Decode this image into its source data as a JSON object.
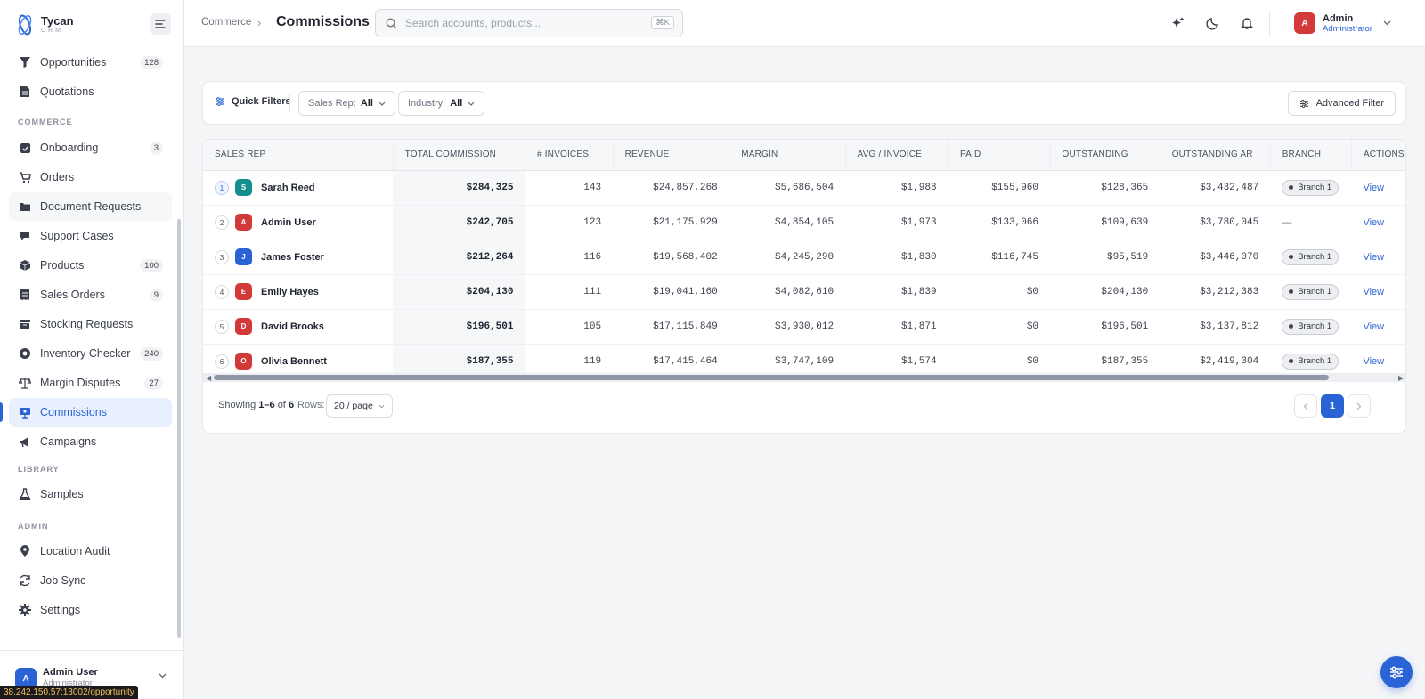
{
  "app": {
    "name": "Tycan",
    "sub": "CRM"
  },
  "sidebar": {
    "items": [
      {
        "label": "Opportunities",
        "count": "128",
        "icon": "funnel-icon"
      },
      {
        "label": "Quotations",
        "count": "",
        "icon": "document-icon"
      },
      {
        "label": "Onboarding",
        "count": "3",
        "icon": "clipboard-icon"
      },
      {
        "label": "Orders",
        "count": "",
        "icon": "cart-icon"
      },
      {
        "label": "Document Requests",
        "count": "",
        "icon": "folder-icon"
      },
      {
        "label": "Support Cases",
        "count": "",
        "icon": "chat-icon"
      },
      {
        "label": "Products",
        "count": "100",
        "icon": "box-icon"
      },
      {
        "label": "Sales Orders",
        "count": "9",
        "icon": "receipt-icon"
      },
      {
        "label": "Stocking Requests",
        "count": "",
        "icon": "archive-icon"
      },
      {
        "label": "Inventory Checker",
        "count": "240",
        "icon": "scan-icon"
      },
      {
        "label": "Margin Disputes",
        "count": "27",
        "icon": "scale-icon"
      },
      {
        "label": "Commissions",
        "count": "",
        "icon": "monitor-icon"
      },
      {
        "label": "Campaigns",
        "count": "",
        "icon": "megaphone-icon"
      },
      {
        "label": "Samples",
        "count": "",
        "icon": "flask-icon"
      },
      {
        "label": "Location Audit",
        "count": "",
        "icon": "pin-icon"
      },
      {
        "label": "Job Sync",
        "count": "",
        "icon": "sync-icon"
      },
      {
        "label": "Settings",
        "count": "",
        "icon": "gear-icon"
      }
    ],
    "sections": {
      "commerce": "COMMERCE",
      "library": "LIBRARY",
      "admin": "ADMIN"
    },
    "user": {
      "initial": "A",
      "name": "Admin User",
      "role": "Administrator"
    }
  },
  "status_url": "38.242.150.57:13002/opportunity",
  "header": {
    "breadcrumb_parent": "Commerce",
    "breadcrumb_sep": "›",
    "title": "Commissions",
    "search_placeholder": "Search accounts, products...",
    "search_shortcut": "⌘K",
    "account": {
      "initial": "A",
      "name": "Admin",
      "role": "Administrator"
    }
  },
  "filters": {
    "quick_label": "Quick Filters",
    "sales_rep_label": "Sales Rep:",
    "sales_rep_value": "All",
    "industry_label": "Industry:",
    "industry_value": "All",
    "advanced_label": "Advanced Filter"
  },
  "table": {
    "columns": [
      "SALES REP",
      "TOTAL COMMISSION",
      "# INVOICES",
      "REVENUE",
      "MARGIN",
      "AVG / INVOICE",
      "PAID",
      "OUTSTANDING",
      "OUTSTANDING AR",
      "BRANCH",
      "ACTIONS"
    ],
    "rows": [
      {
        "rank": "1",
        "initial": "S",
        "color": "#13908c",
        "name": "Sarah Reed",
        "total": "$284,325",
        "invoices": "143",
        "revenue": "$24,857,268",
        "margin": "$5,686,504",
        "avg": "$1,988",
        "paid": "$155,960",
        "outstanding": "$128,365",
        "ar": "$3,432,487",
        "branch": "Branch 1",
        "action": "View"
      },
      {
        "rank": "2",
        "initial": "A",
        "color": "#d23a3a",
        "name": "Admin User",
        "total": "$242,705",
        "invoices": "123",
        "revenue": "$21,175,929",
        "margin": "$4,854,105",
        "avg": "$1,973",
        "paid": "$133,066",
        "outstanding": "$109,639",
        "ar": "$3,780,045",
        "branch": "—",
        "action": "View"
      },
      {
        "rank": "3",
        "initial": "J",
        "color": "#2a63d6",
        "name": "James Foster",
        "total": "$212,264",
        "invoices": "116",
        "revenue": "$19,568,402",
        "margin": "$4,245,290",
        "avg": "$1,830",
        "paid": "$116,745",
        "outstanding": "$95,519",
        "ar": "$3,446,070",
        "branch": "Branch 1",
        "action": "View"
      },
      {
        "rank": "4",
        "initial": "E",
        "color": "#d23a3a",
        "name": "Emily Hayes",
        "total": "$204,130",
        "invoices": "111",
        "revenue": "$19,041,160",
        "margin": "$4,082,610",
        "avg": "$1,839",
        "paid": "$0",
        "outstanding": "$204,130",
        "ar": "$3,212,383",
        "branch": "Branch 1",
        "action": "View"
      },
      {
        "rank": "5",
        "initial": "D",
        "color": "#d23a3a",
        "name": "David Brooks",
        "total": "$196,501",
        "invoices": "105",
        "revenue": "$17,115,849",
        "margin": "$3,930,012",
        "avg": "$1,871",
        "paid": "$0",
        "outstanding": "$196,501",
        "ar": "$3,137,812",
        "branch": "Branch 1",
        "action": "View"
      },
      {
        "rank": "6",
        "initial": "O",
        "color": "#d23a3a",
        "name": "Olivia Bennett",
        "total": "$187,355",
        "invoices": "119",
        "revenue": "$17,415,464",
        "margin": "$3,747,109",
        "avg": "$1,574",
        "paid": "$0",
        "outstanding": "$187,355",
        "ar": "$2,419,304",
        "branch": "Branch 1",
        "action": "View"
      }
    ]
  },
  "pagination": {
    "showing_prefix": "Showing",
    "range": "1–6",
    "of": "of",
    "total": "6",
    "rows_label": "Rows:",
    "rows_value": "20 / page",
    "current_page": "1"
  },
  "colors": {
    "accent": "#2a63d6",
    "danger": "#d23a3a",
    "teal": "#13908c"
  }
}
